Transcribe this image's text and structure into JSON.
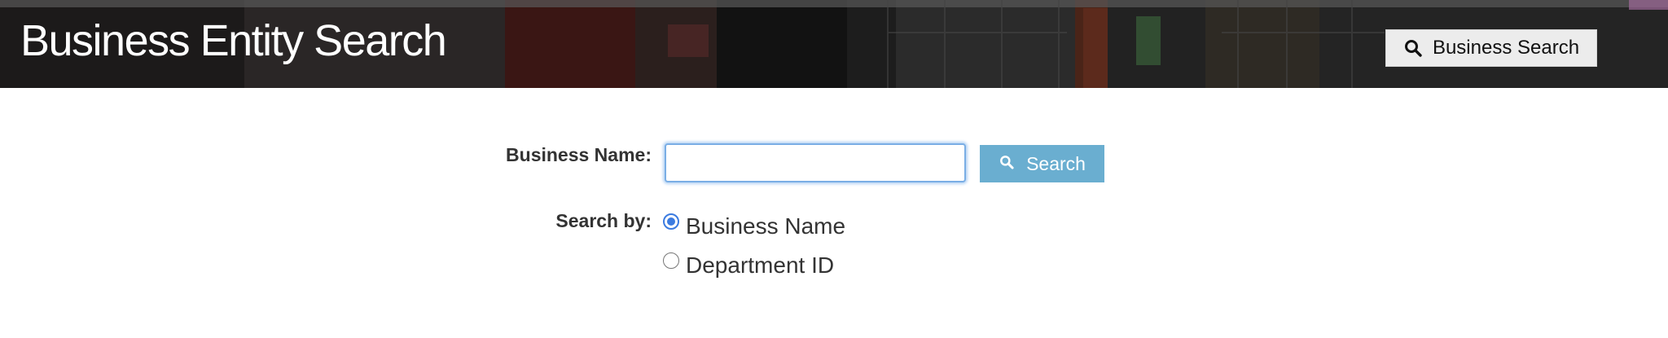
{
  "header": {
    "title": "Business Entity Search",
    "nav_search_label": "Business Search",
    "nav_search_icon": "search-icon"
  },
  "form": {
    "business_name_label": "Business Name:",
    "business_name_value": "",
    "business_name_placeholder": "",
    "search_button_label": "Search",
    "search_button_icon": "search-icon",
    "search_by_label": "Search by:",
    "search_by_options": [
      {
        "label": "Business Name",
        "selected": true
      },
      {
        "label": "Department ID",
        "selected": false
      }
    ]
  },
  "colors": {
    "search_button": "#6aaed0",
    "radio_selected": "#3b7be0",
    "input_focus_border": "#7aaee5"
  }
}
